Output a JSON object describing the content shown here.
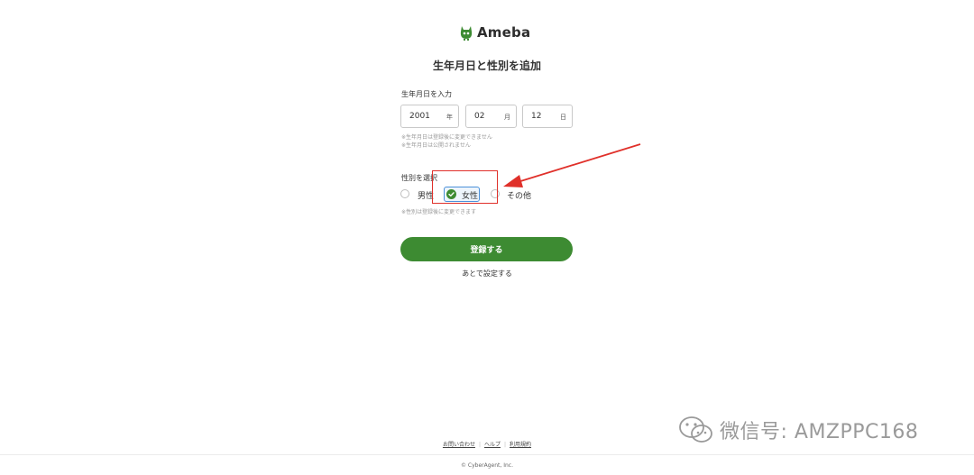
{
  "brand": {
    "name": "Ameba",
    "color": "#3d8b32"
  },
  "page": {
    "title": "生年月日と性別を追加"
  },
  "birthdate": {
    "label": "生年月日を入力",
    "year": {
      "value": "2001",
      "unit": "年"
    },
    "month": {
      "value": "02",
      "unit": "月"
    },
    "day": {
      "value": "12",
      "unit": "日"
    },
    "notes": [
      "※生年月日は登録後に変更できません",
      "※生年月日は公開されません"
    ]
  },
  "gender": {
    "label": "性別を選択",
    "options": [
      {
        "label": "男性",
        "selected": false
      },
      {
        "label": "女性",
        "selected": true
      },
      {
        "label": "その他",
        "selected": false
      }
    ],
    "note": "※性別は登録後に変更できます"
  },
  "actions": {
    "submit_label": "登録する",
    "later_label": "あとで設定する"
  },
  "footer": {
    "links": [
      "お問い合わせ",
      "ヘルプ",
      "利用規約"
    ],
    "copyright": "© CyberAgent, Inc."
  },
  "watermark": {
    "text": "微信号: AMZPPC168",
    "icon": "wechat-icon"
  },
  "annotation": {
    "highlight_color": "#e0302a",
    "target": "女性"
  }
}
